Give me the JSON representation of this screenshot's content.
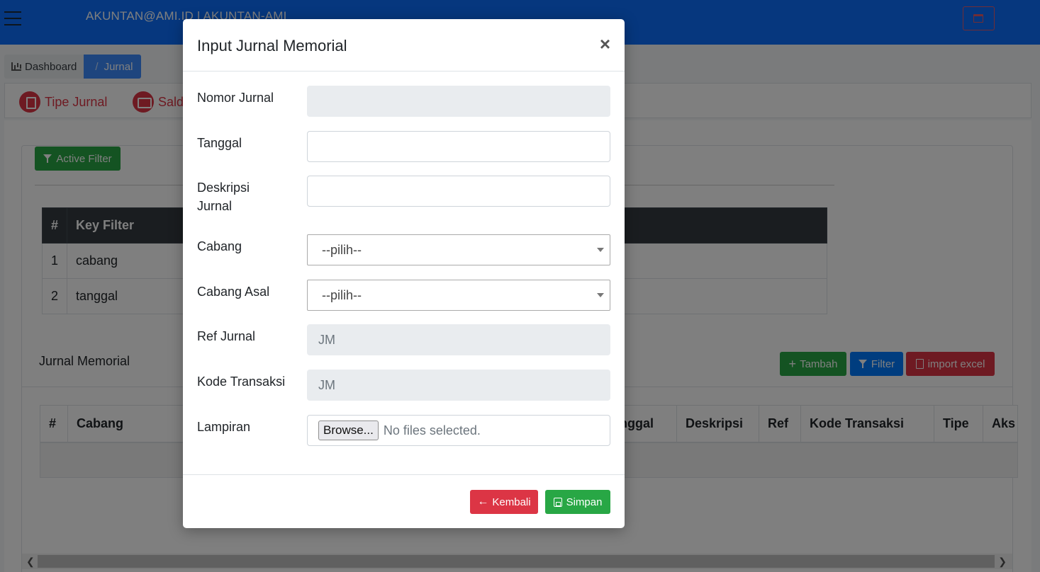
{
  "header": {
    "user_label": "AKUNTAN@AMI.ID | AKUNTAN-AMI"
  },
  "breadcrumb": {
    "dashboard": "Dashboard",
    "separator": "/",
    "current": "Jurnal"
  },
  "tabs": [
    {
      "label": "Tipe Jurnal",
      "icon": "file-icon"
    },
    {
      "label": "Saldo",
      "icon": "money-icon"
    }
  ],
  "filter": {
    "active_filter_label": "Active Filter",
    "table_headers": [
      "#",
      "Key Filter"
    ],
    "rows": [
      {
        "num": "1",
        "key": "cabang"
      },
      {
        "num": "2",
        "key": "tanggal"
      }
    ]
  },
  "journal": {
    "title": "Jurnal Memorial",
    "buttons": {
      "tambah": "Tambah",
      "filter": "Filter",
      "import": "import excel"
    },
    "table_headers": [
      "#",
      "Cabang",
      "nggal",
      "Deskripsi",
      "Ref",
      "Kode Transaksi",
      "Tipe",
      "Aks"
    ]
  },
  "modal": {
    "title": "Input Jurnal Memorial",
    "close": "×",
    "fields": {
      "nomor_jurnal": {
        "label": "Nomor Jurnal",
        "value": ""
      },
      "tanggal": {
        "label": "Tanggal",
        "value": ""
      },
      "deskripsi": {
        "label_line1": "Deskripsi",
        "label_line2": "Jurnal",
        "value": ""
      },
      "cabang": {
        "label": "Cabang",
        "value": "--pilih--"
      },
      "cabang_asal": {
        "label": "Cabang Asal",
        "value": "--pilih--"
      },
      "ref_jurnal": {
        "label": "Ref Jurnal",
        "value": "JM"
      },
      "kode_transaksi": {
        "label": "Kode Transaksi",
        "value": "JM"
      },
      "lampiran": {
        "label": "Lampiran",
        "browse": "Browse...",
        "status": "No files selected."
      }
    },
    "buttons": {
      "back": "Kembali",
      "save": "Simpan"
    }
  },
  "colors": {
    "primary": "#0d6efd",
    "success": "#28a745",
    "danger": "#dc3545",
    "dark": "#343a40"
  }
}
